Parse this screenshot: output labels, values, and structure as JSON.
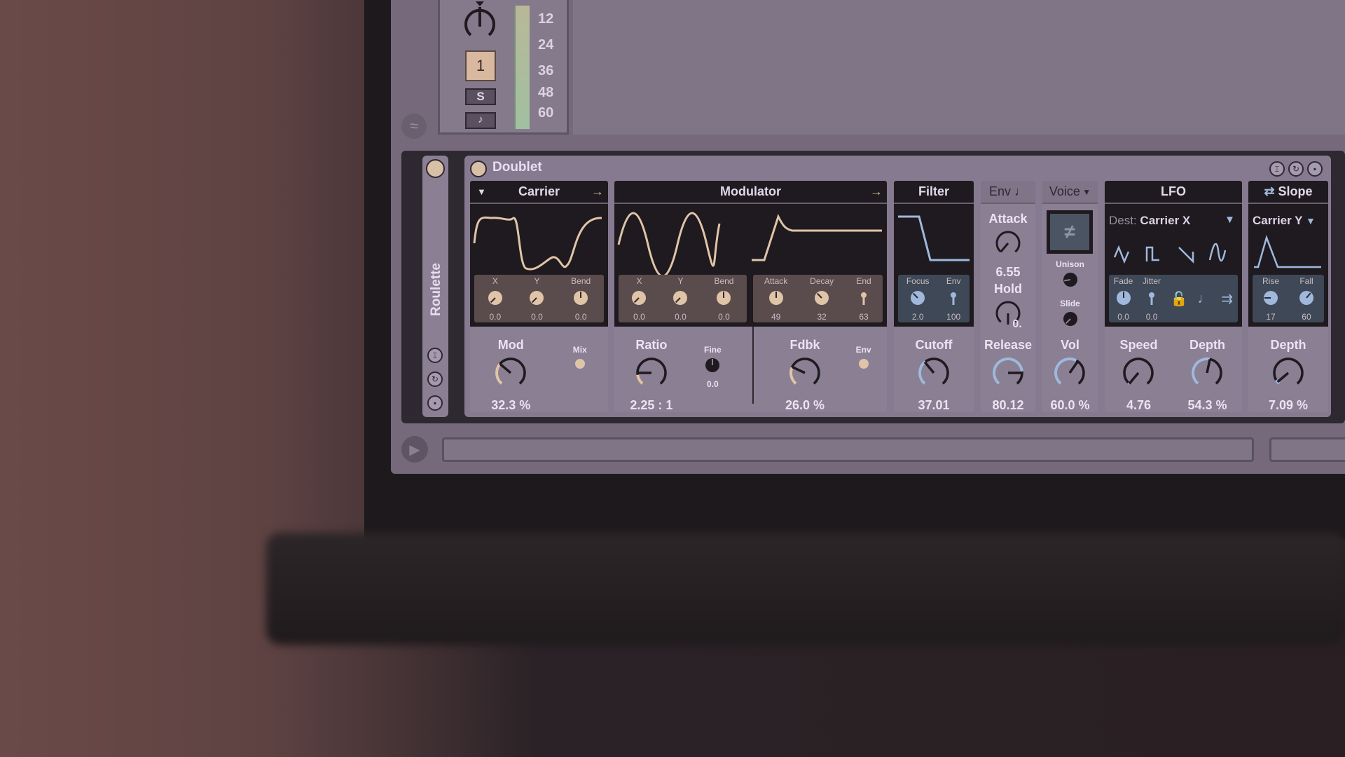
{
  "mixer": {
    "track_number": "1",
    "solo_label": "S",
    "meter_ticks": [
      "12",
      "24",
      "36",
      "48",
      "60"
    ]
  },
  "rack": {
    "name": "Roulette"
  },
  "device": {
    "name": "Doublet",
    "carrier": {
      "title": "Carrier",
      "params": [
        {
          "label": "X",
          "value": "0.0"
        },
        {
          "label": "Y",
          "value": "0.0"
        },
        {
          "label": "Bend",
          "value": "0.0"
        }
      ],
      "mod": {
        "label": "Mod",
        "value": "32.3 %"
      },
      "mix_label": "Mix"
    },
    "modulator": {
      "title": "Modulator",
      "params": [
        {
          "label": "X",
          "value": "0.0"
        },
        {
          "label": "Y",
          "value": "0.0"
        },
        {
          "label": "Bend",
          "value": "0.0"
        }
      ],
      "env_params": [
        {
          "label": "Attack",
          "value": "49"
        },
        {
          "label": "Decay",
          "value": "32"
        },
        {
          "label": "End",
          "value": "63"
        }
      ],
      "ratio": {
        "label": "Ratio",
        "value": "2.25 : 1"
      },
      "fine": {
        "label": "Fine",
        "value": "0.0"
      },
      "fdbk": {
        "label": "Fdbk",
        "value": "26.0 %"
      },
      "env_label": "Env"
    },
    "filter": {
      "title": "Filter",
      "params": [
        {
          "label": "Focus",
          "value": "2.0"
        },
        {
          "label": "Env",
          "value": "100"
        }
      ],
      "cutoff": {
        "label": "Cutoff",
        "value": "37.01"
      }
    },
    "env": {
      "title": "Env",
      "attack": {
        "label": "Attack",
        "value": "6.55"
      },
      "hold": {
        "label": "Hold",
        "value": "0."
      },
      "release": {
        "label": "Release",
        "value": "80.12"
      }
    },
    "voice": {
      "title": "Voice",
      "unison_label": "Unison",
      "slide_label": "Slide",
      "vol": {
        "label": "Vol",
        "value": "60.0 %"
      }
    },
    "lfo": {
      "title": "LFO",
      "dest_label": "Dest:",
      "dest_value": "Carrier X",
      "params": [
        {
          "label": "Fade",
          "value": "0.0"
        },
        {
          "label": "Jitter",
          "value": "0.0"
        }
      ],
      "speed": {
        "label": "Speed",
        "value": "4.76"
      },
      "depth": {
        "label": "Depth",
        "value": "54.3 %"
      }
    },
    "slope": {
      "title": "Slope",
      "dest_value": "Carrier Y",
      "params": [
        {
          "label": "Rise",
          "value": "17"
        },
        {
          "label": "Fall",
          "value": "60"
        }
      ],
      "depth": {
        "label": "Depth",
        "value": "7.09 %"
      }
    }
  },
  "colors": {
    "accent": "#e0c4a8",
    "blue": "#9fb8dc",
    "panel": "#857a8f",
    "display": "#1e1a1f"
  }
}
